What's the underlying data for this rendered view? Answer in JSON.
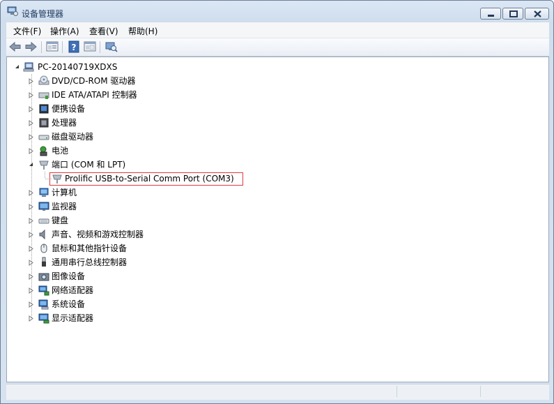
{
  "window": {
    "title": "设备管理器"
  },
  "menu": [
    {
      "label": "文件(F)"
    },
    {
      "label": "操作(A)"
    },
    {
      "label": "查看(V)"
    },
    {
      "label": "帮助(H)"
    }
  ],
  "toolbar_icons": [
    "back-arrow-icon",
    "forward-arrow-icon",
    "properties-icon",
    "help-icon",
    "console-tree-icon",
    "scan-hardware-icon"
  ],
  "tree": {
    "root": "PC-20140719XDXS",
    "categories": [
      {
        "label": "DVD/CD-ROM 驱动器",
        "icon": "dvd-drive-icon"
      },
      {
        "label": "IDE ATA/ATAPI 控制器",
        "icon": "ide-controller-icon"
      },
      {
        "label": "便携设备",
        "icon": "portable-device-icon"
      },
      {
        "label": "处理器",
        "icon": "processor-icon"
      },
      {
        "label": "磁盘驱动器",
        "icon": "disk-drive-icon"
      },
      {
        "label": "电池",
        "icon": "battery-icon"
      },
      {
        "label": "端口 (COM 和 LPT)",
        "icon": "port-icon"
      },
      {
        "label": "Prolific USB-to-Serial Comm Port (COM3)",
        "icon": "serial-port-icon"
      },
      {
        "label": "计算机",
        "icon": "computer-icon"
      },
      {
        "label": "监视器",
        "icon": "monitor-icon"
      },
      {
        "label": "键盘",
        "icon": "keyboard-icon"
      },
      {
        "label": "声音、视频和游戏控制器",
        "icon": "sound-icon"
      },
      {
        "label": "鼠标和其他指针设备",
        "icon": "mouse-icon"
      },
      {
        "label": "通用串行总线控制器",
        "icon": "usb-icon"
      },
      {
        "label": "图像设备",
        "icon": "imaging-device-icon"
      },
      {
        "label": "网络适配器",
        "icon": "network-adapter-icon"
      },
      {
        "label": "系统设备",
        "icon": "system-device-icon"
      },
      {
        "label": "显示适配器",
        "icon": "display-adapter-icon"
      }
    ]
  },
  "colors": {
    "highlight_border": "#e0383e",
    "title_text": "#1e395b"
  }
}
